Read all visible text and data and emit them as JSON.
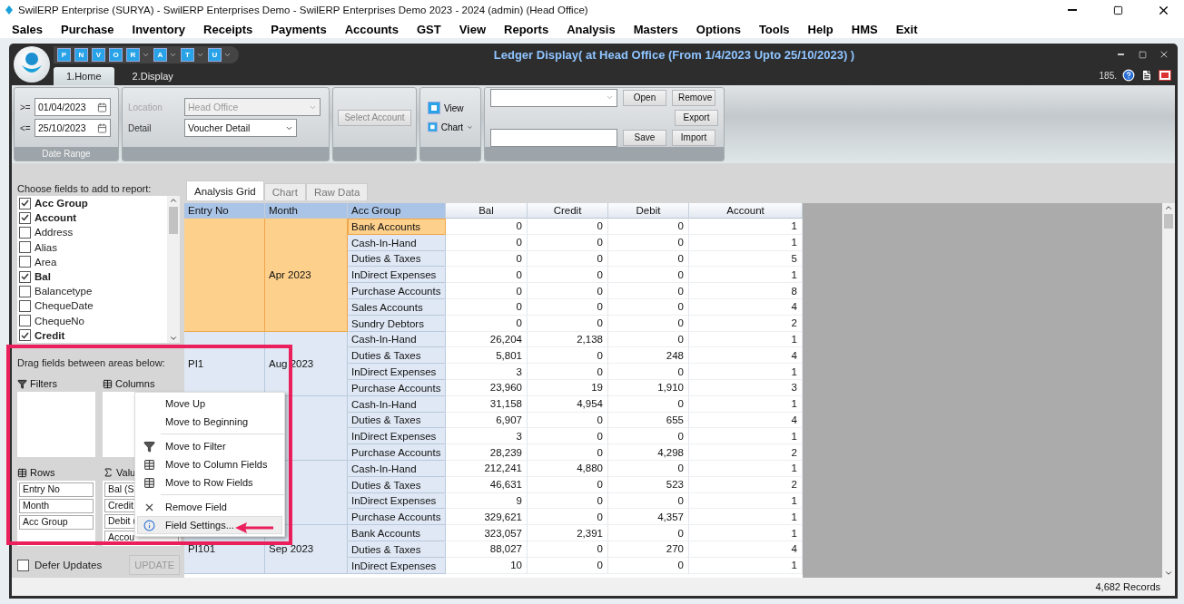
{
  "app": {
    "title": "SwilERP Enterprise (SURYA) - SwilERP Enterprises Demo - SwilERP Enterprises Demo  2023 - 2024 (admin) (Head Office)"
  },
  "menu_bar": [
    "Sales",
    "Purchase",
    "Inventory",
    "Receipts",
    "Payments",
    "Accounts",
    "GST",
    "View",
    "Reports",
    "Analysis",
    "Masters",
    "Options",
    "Tools",
    "Help",
    "HMS",
    "Exit"
  ],
  "document": {
    "title": "Ledger Display( at Head Office  (From 1/4/2023 Upto 25/10/2023) )",
    "counter": "185.",
    "quick_access": [
      {
        "letter": "P",
        "dropdown": false
      },
      {
        "letter": "N",
        "dropdown": false
      },
      {
        "letter": "V",
        "dropdown": false
      },
      {
        "letter": "O",
        "dropdown": false
      },
      {
        "letter": "R",
        "dropdown": true
      },
      {
        "letter": "A",
        "dropdown": true
      },
      {
        "letter": "T",
        "dropdown": true
      },
      {
        "letter": "U",
        "dropdown": true
      }
    ],
    "tabs": [
      {
        "label": "1.Home",
        "selected": true
      },
      {
        "label": "2.Display",
        "selected": false
      }
    ]
  },
  "ribbon": {
    "date_range": {
      "from_label": ">=",
      "from": "01/04/2023",
      "to_label": "<=",
      "to": "25/10/2023",
      "caption": "Date Range"
    },
    "location": {
      "label": "Location",
      "value": "Head Office",
      "disabled": true
    },
    "detail": {
      "label": "Detail",
      "value": "Voucher Detail",
      "disabled": false
    },
    "select_account": {
      "label": "Select Account",
      "disabled": true
    },
    "view": {
      "label": "View"
    },
    "chart": {
      "label": "Chart"
    },
    "layout_buttons": [
      "Open",
      "Remove",
      "Export",
      "Save",
      "Import"
    ]
  },
  "field_list": {
    "caption": "Choose fields to add to report:",
    "fields": [
      {
        "label": "Acc Group",
        "checked": true
      },
      {
        "label": "Account",
        "checked": true
      },
      {
        "label": "Address",
        "checked": false
      },
      {
        "label": "Alias",
        "checked": false
      },
      {
        "label": "Area",
        "checked": false
      },
      {
        "label": "Bal",
        "checked": true
      },
      {
        "label": "Balancetype",
        "checked": false
      },
      {
        "label": "ChequeDate",
        "checked": false
      },
      {
        "label": "ChequeNo",
        "checked": false
      },
      {
        "label": "Credit",
        "checked": true
      }
    ]
  },
  "areas": {
    "caption": "Drag fields between areas below:",
    "filters": {
      "label": "Filters"
    },
    "columns": {
      "label": "Columns"
    },
    "rows": {
      "label": "Rows",
      "items": [
        "Entry No",
        "Month",
        "Acc Group"
      ]
    },
    "values": {
      "label": "Valu",
      "items": [
        "Bal (S",
        "Credit",
        "Debit (",
        "Accou"
      ]
    }
  },
  "defer_updates": {
    "label": "Defer Updates",
    "checked": false
  },
  "update_button": {
    "label": "UPDATE",
    "disabled": true
  },
  "grid_tabs": [
    {
      "label": "Analysis Grid",
      "selected": true
    },
    {
      "label": "Chart",
      "selected": false
    },
    {
      "label": "Raw Data",
      "selected": false
    }
  ],
  "grid": {
    "columns": [
      "Entry No",
      "Month",
      "Acc Group",
      "Bal",
      "Credit",
      "Debit",
      "Account"
    ],
    "groups": [
      {
        "month": "Apr 2023",
        "selected": true,
        "rows": [
          {
            "acc_group": "Bank Accounts",
            "bal": "0",
            "credit": "0",
            "debit": "0",
            "account": "1",
            "focused": true
          },
          {
            "acc_group": "Cash-In-Hand",
            "bal": "0",
            "credit": "0",
            "debit": "0",
            "account": "1",
            "focused": false
          },
          {
            "acc_group": "Duties & Taxes",
            "bal": "0",
            "credit": "0",
            "debit": "0",
            "account": "5",
            "focused": false
          },
          {
            "acc_group": "InDirect Expenses",
            "bal": "0",
            "credit": "0",
            "debit": "0",
            "account": "1",
            "focused": false
          },
          {
            "acc_group": "Purchase Accounts",
            "bal": "0",
            "credit": "0",
            "debit": "0",
            "account": "8",
            "focused": false
          },
          {
            "acc_group": "Sales Accounts",
            "bal": "0",
            "credit": "0",
            "debit": "0",
            "account": "4",
            "focused": false
          },
          {
            "acc_group": "Sundry Debtors",
            "bal": "0",
            "credit": "0",
            "debit": "0",
            "account": "2",
            "focused": false
          }
        ]
      },
      {
        "entry_no": "PI1",
        "month": "Aug 2023",
        "selected": false,
        "rows": [
          {
            "acc_group": "Cash-In-Hand",
            "bal": "26,204",
            "credit": "2,138",
            "debit": "0",
            "account": "1",
            "focused": false
          },
          {
            "acc_group": "Duties & Taxes",
            "bal": "5,801",
            "credit": "0",
            "debit": "248",
            "account": "4",
            "focused": false
          },
          {
            "acc_group": "InDirect Expenses",
            "bal": "3",
            "credit": "0",
            "debit": "0",
            "account": "1",
            "focused": false
          },
          {
            "acc_group": "Purchase Accounts",
            "bal": "23,960",
            "credit": "19",
            "debit": "1,910",
            "account": "3",
            "focused": false
          }
        ]
      },
      {
        "selected": false,
        "rows": [
          {
            "acc_group": "Cash-In-Hand",
            "bal": "31,158",
            "credit": "4,954",
            "debit": "0",
            "account": "1",
            "focused": false
          },
          {
            "acc_group": "Duties & Taxes",
            "bal": "6,907",
            "credit": "0",
            "debit": "655",
            "account": "4",
            "focused": false
          },
          {
            "acc_group": "InDirect Expenses",
            "bal": "3",
            "credit": "0",
            "debit": "0",
            "account": "1",
            "focused": false
          },
          {
            "acc_group": "Purchase Accounts",
            "bal": "28,239",
            "credit": "0",
            "debit": "4,298",
            "account": "2",
            "focused": false
          }
        ]
      },
      {
        "selected": false,
        "rows": [
          {
            "acc_group": "Cash-In-Hand",
            "bal": "212,241",
            "credit": "4,880",
            "debit": "0",
            "account": "1",
            "focused": false
          },
          {
            "acc_group": "Duties & Taxes",
            "bal": "46,631",
            "credit": "0",
            "debit": "523",
            "account": "2",
            "focused": false
          },
          {
            "acc_group": "InDirect Expenses",
            "bal": "9",
            "credit": "0",
            "debit": "0",
            "account": "1",
            "focused": false
          },
          {
            "acc_group": "Purchase Accounts",
            "bal": "329,621",
            "credit": "0",
            "debit": "4,357",
            "account": "1",
            "focused": false
          }
        ]
      },
      {
        "entry_no": "PI101",
        "month": "Sep 2023",
        "selected": false,
        "rows": [
          {
            "acc_group": "Bank Accounts",
            "bal": "323,057",
            "credit": "2,391",
            "debit": "0",
            "account": "1",
            "focused": false
          },
          {
            "acc_group": "Duties & Taxes",
            "bal": "88,027",
            "credit": "0",
            "debit": "270",
            "account": "4",
            "focused": false
          },
          {
            "acc_group": "InDirect Expenses",
            "bal": "10",
            "credit": "0",
            "debit": "0",
            "account": "1",
            "focused": false
          }
        ]
      }
    ]
  },
  "context_menu": {
    "groups": [
      [
        {
          "label": "Move Up",
          "selected": false
        },
        {
          "label": "Move to Beginning",
          "selected": false
        }
      ],
      [
        {
          "label": "Move to Filter",
          "selected": false
        },
        {
          "label": "Move to Column Fields",
          "selected": false
        },
        {
          "label": "Move to Row Fields",
          "selected": false
        }
      ],
      [
        {
          "label": "Remove Field",
          "selected": false
        },
        {
          "label": "Field Settings...",
          "selected": true
        }
      ]
    ]
  },
  "status_bar": {
    "records": "4,682 Records"
  }
}
